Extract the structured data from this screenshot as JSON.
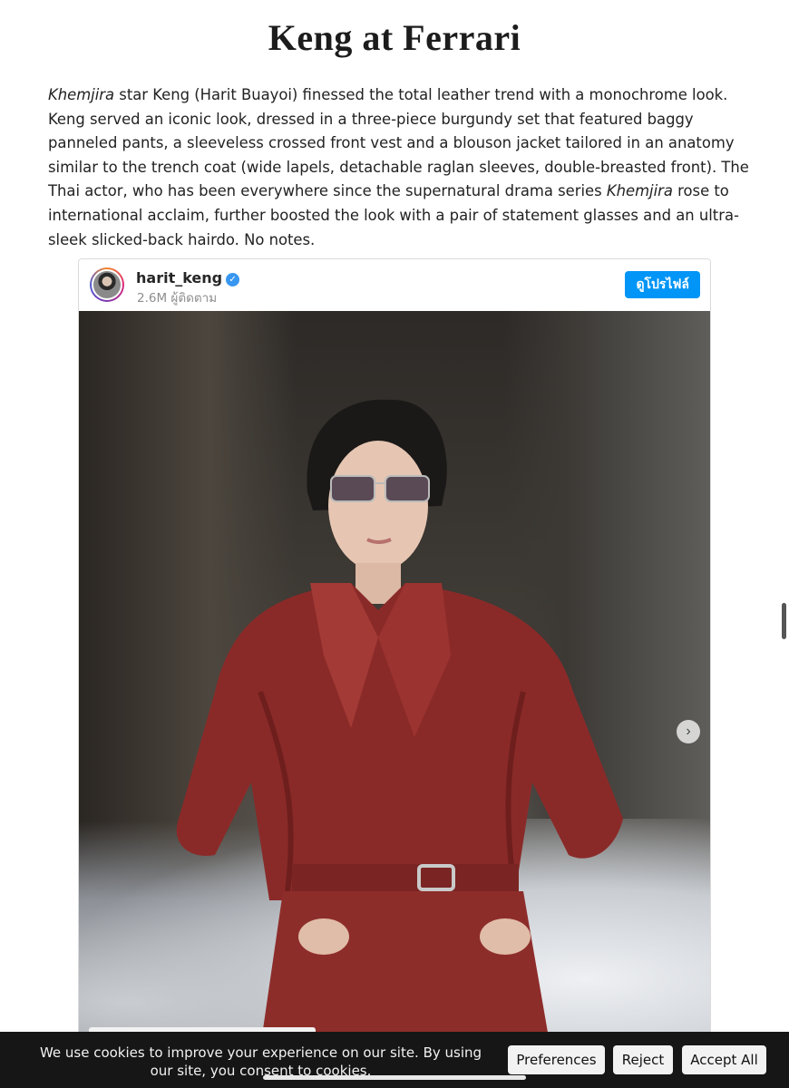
{
  "article": {
    "title": "Keng at Ferrari",
    "paragraph": {
      "italic_1": "Khemjira",
      "text_1": " star Keng (Harit Buayoi) finessed the total leather trend with a monochrome look. Keng served an iconic look, dressed in a three-piece burgundy set that featured baggy panneled pants, a sleeveless crossed front vest and a blouson jacket tailored in an anatomy similar to the trench coat (wide lapels, detachable raglan sleeves, double-breasted front). The Thai actor, who has been everywhere since the supernatural drama series ",
      "italic_2": "Khemjira",
      "text_2": " rose to international acclaim, further boosted the look with a pair of statement glasses and an ultra-sleek slicked-back hairdo. No notes."
    }
  },
  "instagram_embed": {
    "username": "harit_keng",
    "verified_icon": "check",
    "followers": "2.6M ผู้ติดตาม",
    "view_profile_label": "ดูโปรไฟล์",
    "carousel_next_icon": "›"
  },
  "cookie_banner": {
    "message": "We use cookies to improve your experience on our site. By using our site, you consent to cookies.",
    "preferences_label": "Preferences",
    "reject_label": "Reject",
    "accept_label": "Accept All"
  },
  "colors": {
    "instagram_blue": "#0095f6",
    "cookie_bar": "#161616"
  }
}
